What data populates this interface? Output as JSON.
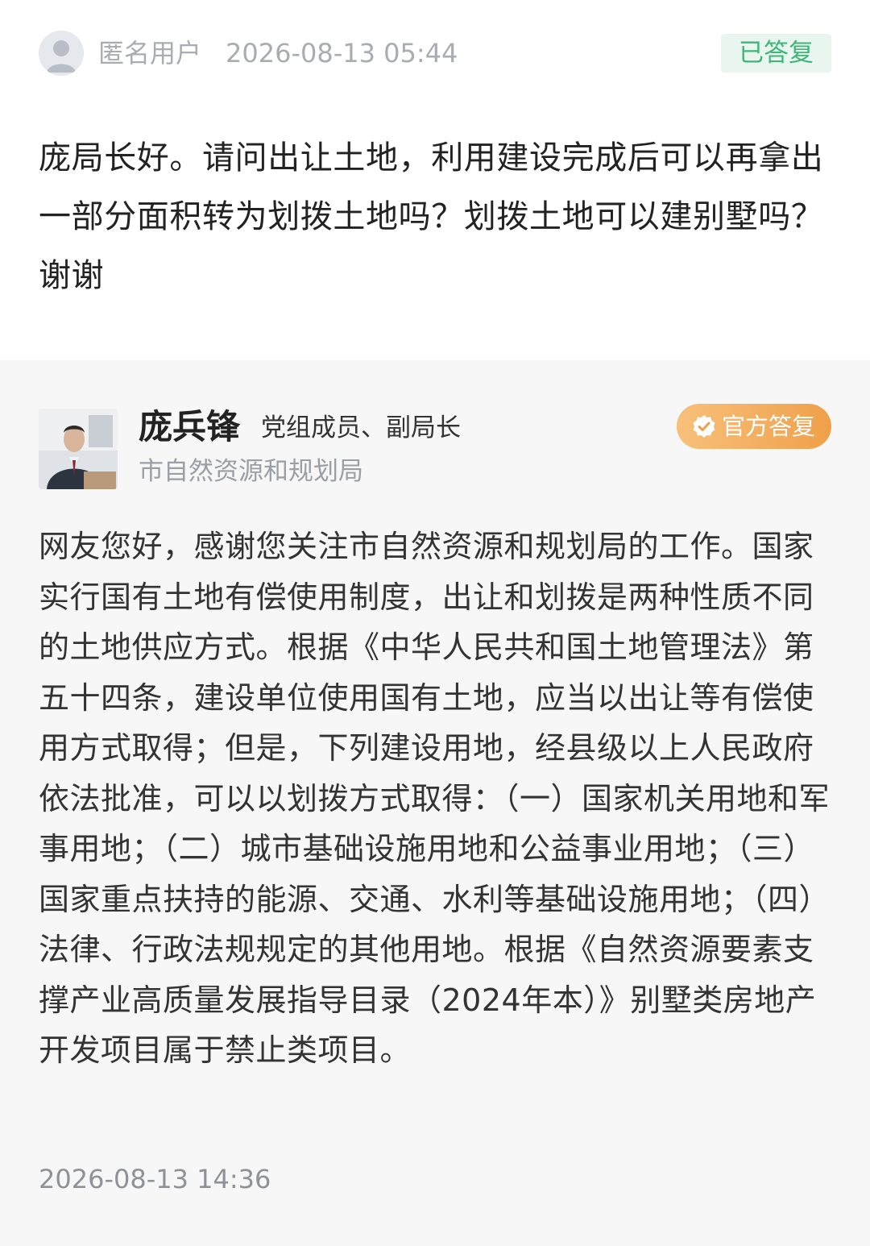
{
  "question": {
    "asker_name": "匿名用户",
    "asked_time": "2026-08-13 05:44",
    "status_label": "已答复",
    "text": "庞局长好。请问出让土地，利用建设完成后可以再拿出一部分面积转为划拨土地吗？划拨土地可以建别墅吗？谢谢"
  },
  "answer": {
    "official_name": "庞兵锋",
    "official_title": "党组成员、副局长",
    "department": "市自然资源和规划局",
    "badge_label": "官方答复",
    "badge_icon": "verified-check-icon",
    "text": "网友您好，感谢您关注市自然资源和规划局的工作。国家实行国有土地有偿使用制度，出让和划拨是两种性质不同的土地供应方式。根据《中华人民共和国土地管理法》第五十四条，建设单位使用国有土地，应当以出让等有偿使用方式取得；但是，下列建设用地，经县级以上人民政府依法批准，可以以划拨方式取得：（一）国家机关用地和军事用地；（二）城市基础设施用地和公益事业用地；（三）国家重点扶持的能源、交通、水利等基础设施用地；（四）法律、行政法规规定的其他用地。根据《自然资源要素支撑产业高质量发展指导目录（2024年本）》别墅类房地产开发项目属于禁止类项目。",
    "answered_time": "2026-08-13 14:36"
  },
  "colors": {
    "status_green": "#3fb57a",
    "status_bg": "#e8f6ef",
    "badge_orange": "#f0a04a",
    "answer_bg": "#f7f7f7"
  }
}
